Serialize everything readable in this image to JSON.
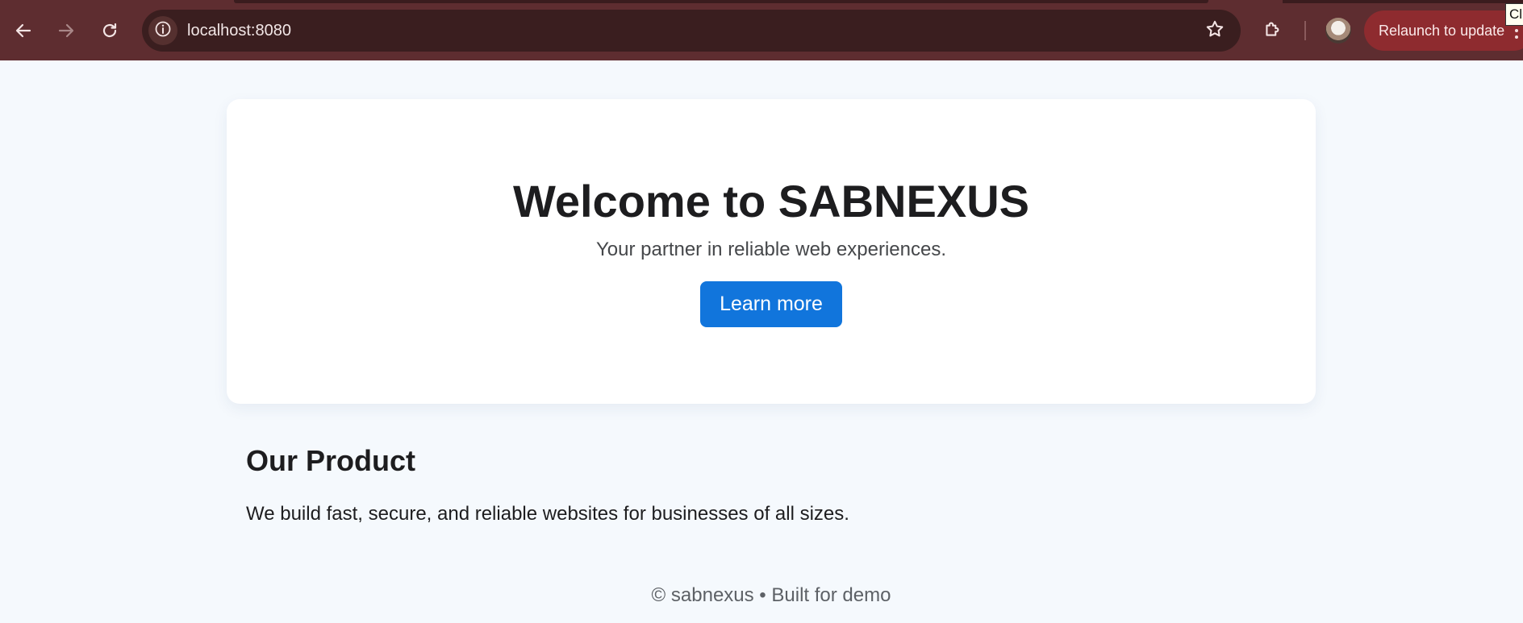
{
  "browser": {
    "url": "localhost:8080",
    "relaunch_label": "Relaunch to update",
    "tooltip_text": "Cl",
    "icons": {
      "back": "arrow-left-icon",
      "forward": "arrow-right-icon",
      "reload": "reload-icon",
      "site_info": "info-icon",
      "bookmark": "star-icon",
      "extensions": "puzzle-icon",
      "menu": "kebab-menu-icon"
    },
    "colors": {
      "toolbar": "#5e2d30",
      "omnibox": "#3a1e1f",
      "relaunch": "#8e2b2f"
    }
  },
  "hero": {
    "title": "Welcome to SABNEXUS",
    "subtitle": "Your partner in reliable web experiences.",
    "cta_label": "Learn more"
  },
  "product": {
    "title": "Our Product",
    "text": "We build fast, secure, and reliable websites for businesses of all sizes."
  },
  "footer": {
    "text": "© sabnexus • Built for demo"
  },
  "colors": {
    "page_background": "#f5f9fd",
    "accent": "#1175dc",
    "card": "#ffffff"
  }
}
